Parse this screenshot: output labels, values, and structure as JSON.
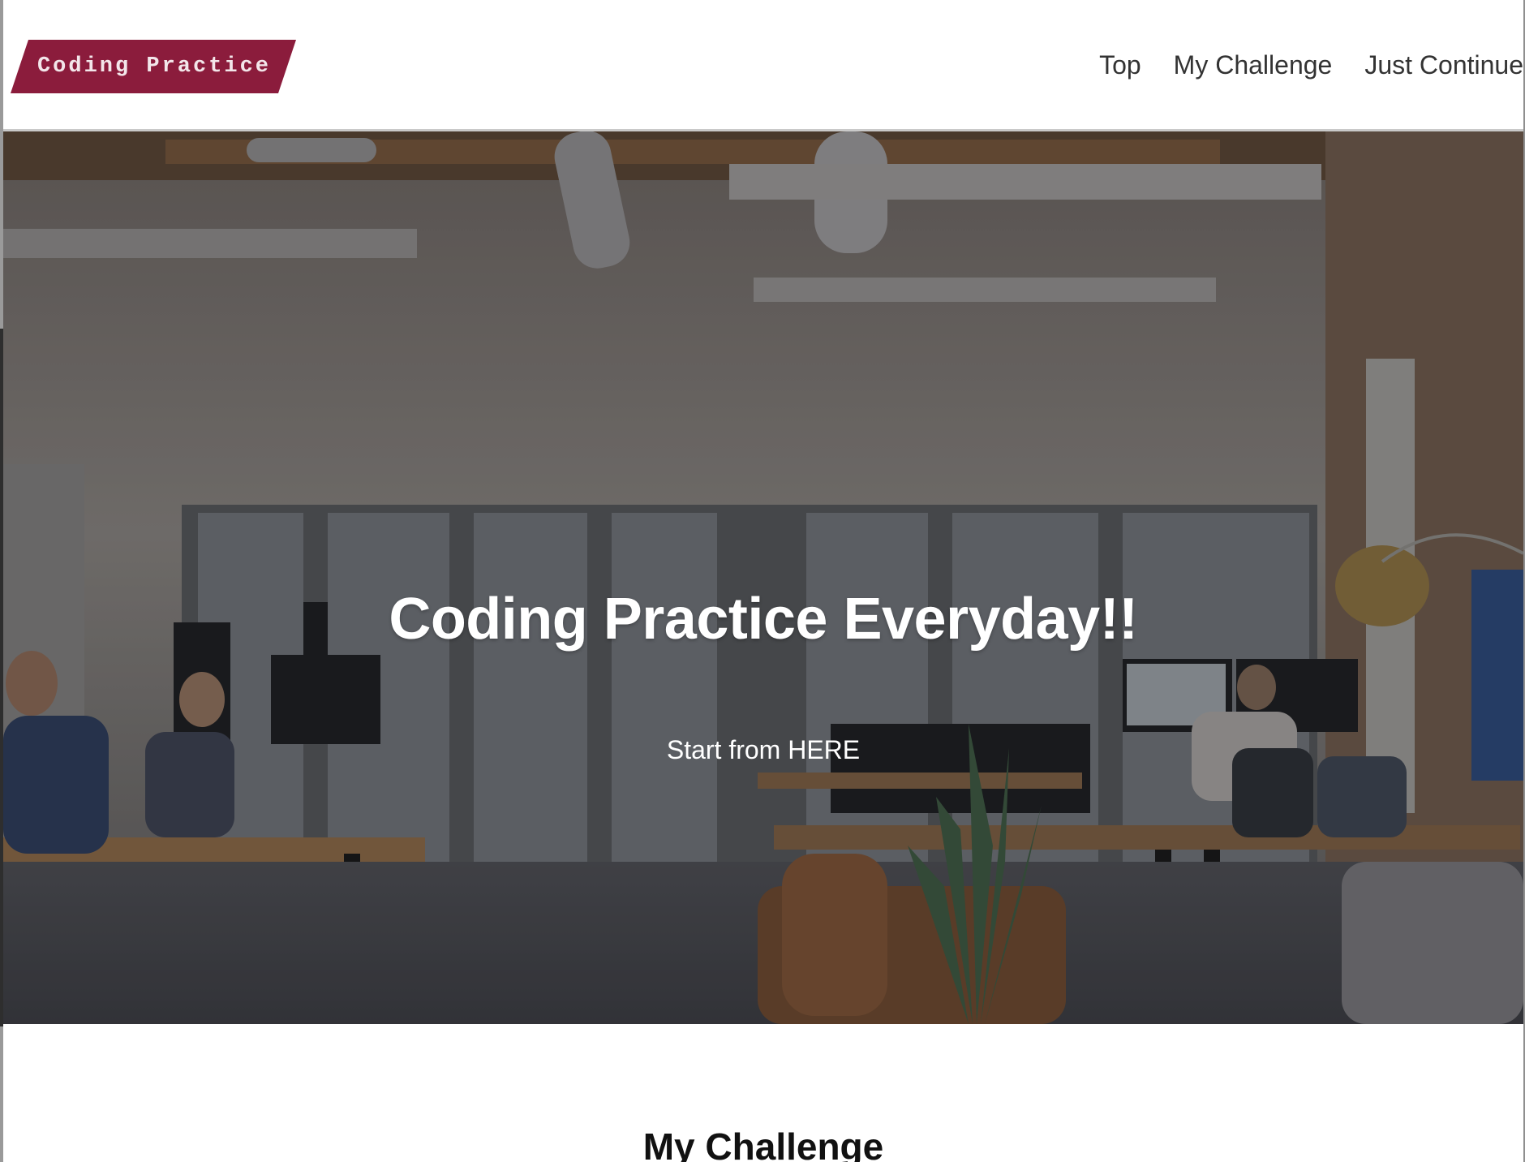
{
  "header": {
    "logo_text": "Coding Practice",
    "nav": [
      {
        "label": "Top"
      },
      {
        "label": "My Challenge"
      },
      {
        "label": "Just Continue"
      }
    ]
  },
  "hero": {
    "title": "Coding Practice Everyday!!",
    "cta_label": "Start from HERE",
    "background_image": "office-workspace-photo"
  },
  "sections": {
    "challenge_title": "My Challenge"
  },
  "colors": {
    "brand": "#8b1c3c",
    "text_nav": "#333333",
    "hero_text": "#ffffff"
  }
}
